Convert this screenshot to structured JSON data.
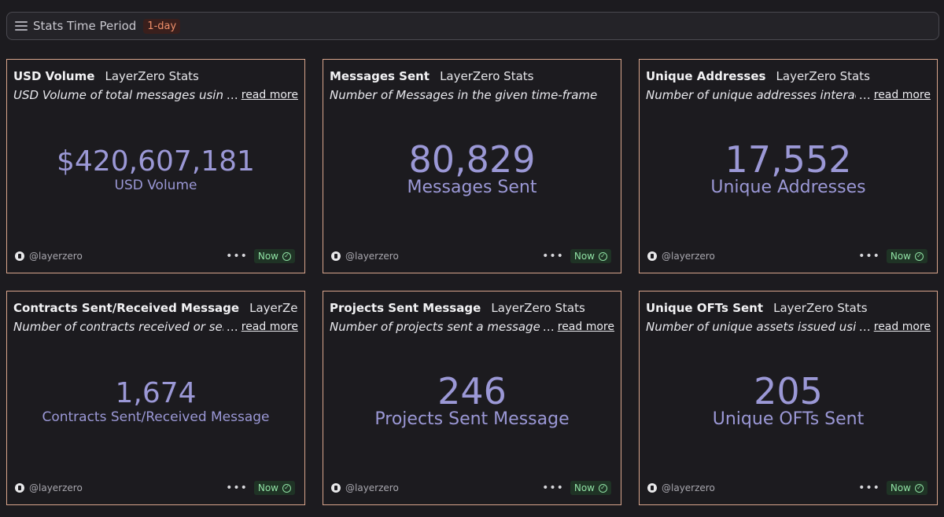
{
  "header": {
    "title": "Stats Time Period",
    "period": "1-day"
  },
  "cards": [
    {
      "title": "USD Volume",
      "source": "LayerZero Stats",
      "description": "USD Volume of total messages using La",
      "read_more": "read more",
      "value": "$420,607,181",
      "label": "USD Volume",
      "handle": "@layerzero",
      "status": "Now"
    },
    {
      "title": "Messages Sent",
      "source": "LayerZero Stats",
      "description": "Number of Messages in the given time-frame",
      "read_more": "",
      "value": "80,829",
      "label": "Messages Sent",
      "handle": "@layerzero",
      "status": "Now"
    },
    {
      "title": "Unique Addresses",
      "source": "LayerZero Stats",
      "description": "Number of unique addresses interacte",
      "read_more": "read more",
      "value": "17,552",
      "label": "Unique Addresses",
      "handle": "@layerzero",
      "status": "Now"
    },
    {
      "title": "Contracts Sent/Received Message",
      "source": "LayerZero Stat",
      "description": "Number of contracts received or sent a",
      "read_more": "read more",
      "value": "1,674",
      "label": "Contracts Sent/Received Message",
      "handle": "@layerzero",
      "status": "Now"
    },
    {
      "title": "Projects Sent Message",
      "source": "LayerZero Stats",
      "description": "Number of projects sent a message in",
      "read_more": "read more",
      "value": "246",
      "label": "Projects Sent Message",
      "handle": "@layerzero",
      "status": "Now"
    },
    {
      "title": "Unique OFTs Sent",
      "source": "LayerZero Stats",
      "description": "Number of unique assets issued using",
      "read_more": "read more",
      "value": "205",
      "label": "Unique OFTs Sent",
      "handle": "@layerzero",
      "status": "Now"
    }
  ]
}
